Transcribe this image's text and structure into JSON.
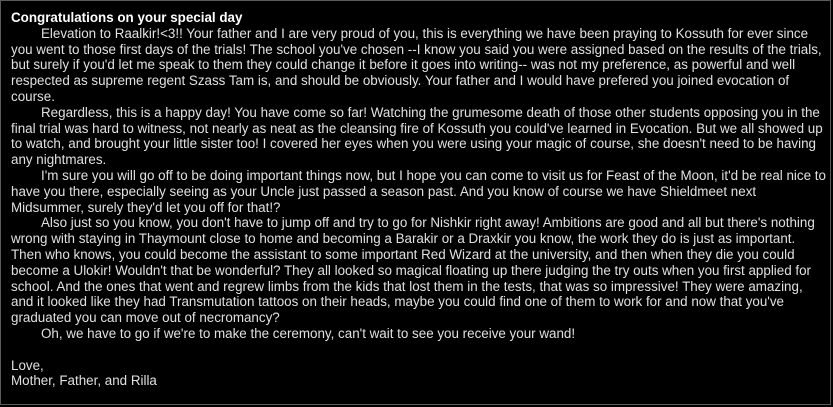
{
  "letter": {
    "title": "Congratulations on your special day",
    "paragraphs": [
      "Elevation to Raalkir!<3!! Your father and I are very proud of you, this is everything we have been praying to Kossuth for ever since you went to those first days of the trials! The school you've chosen --I know you said you were assigned based on the results of the trials, but surely if you'd let me speak to them they could change it before it goes into writing-- was not my preference, as powerful and well respected as supreme regent Szass Tam is, and should be obviously. Your father and I would have prefered you joined evocation of course.",
      "Regardless, this is a happy day! You have come so far! Watching the grumesome death of those other students opposing you in the final trial was hard to witness, not nearly as neat as the cleansing fire of Kossuth you could've learned in Evocation. But we all showed up to watch, and brought your little sister too! I covered her eyes when you were using your magic of course, she doesn't need to be having any nightmares.",
      "I'm sure you will go off to be doing important things now, but I hope you can come to visit us for Feast of the Moon, it'd be real nice to have you there, especially seeing as your Uncle just passed a season past. And you know of course we have Shieldmeet next Midsummer, surely they'd let you off for that!?",
      "Also just so you know, you don't have to jump off and try to go for Nishkir right away! Ambitions are good and all but there's nothing wrong with staying in Thaymount close to home and becoming a Barakir or a Draxkir you know, the work they do is just as important. Then who knows, you could become the assistant to some important Red Wizard at the university, and then when they die you could become a Ulokir! Wouldn't that be wonderful? They all looked so magical floating up there judging the try outs when you first applied for school. And the ones that went and regrew limbs from the kids that lost them in the tests, that was so impressive! They were amazing, and it looked like they had Transmutation tattoos on their heads, maybe you could find one of them to work for and now that you've graduated you can move out of necromancy?",
      "Oh, we have to go if we're to make the ceremony, can't wait to see you receive your wand!"
    ],
    "signoff": "Love,",
    "signature": "Mother, Father, and Rilla"
  },
  "colors": {
    "background": "#000000",
    "text": "#e0e0e0",
    "border": "#5a5a5a"
  }
}
